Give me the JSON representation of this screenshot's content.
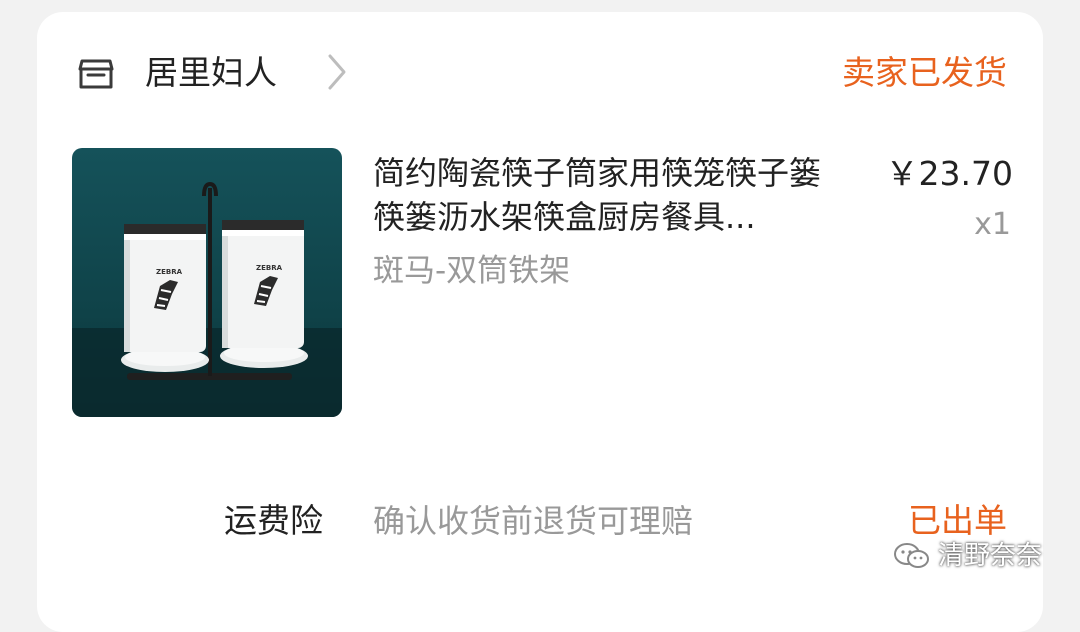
{
  "shop": {
    "name": "居里妇人",
    "icon": "shop-icon",
    "chevron_icon": "chevron-right-icon"
  },
  "order": {
    "status": "卖家已发货"
  },
  "product": {
    "image_icon": "product-image",
    "title": "简约陶瓷筷子筒家用筷笼筷子篓筷篓沥水架筷盒厨房餐具...",
    "sku": "斑马-双筒铁架",
    "price": "￥23.70",
    "quantity": "x1",
    "image_text": "ZEBRA"
  },
  "insurance": {
    "label": "运费险",
    "description": "确认收货前退货可理赔",
    "status": "已出单"
  },
  "watermark": {
    "text": "清野奈奈",
    "icon": "wechat-icon"
  },
  "colors": {
    "accent": "#e8621e",
    "text": "#222222",
    "muted": "#999999",
    "background": "#f2f2f2",
    "card": "#ffffff"
  }
}
